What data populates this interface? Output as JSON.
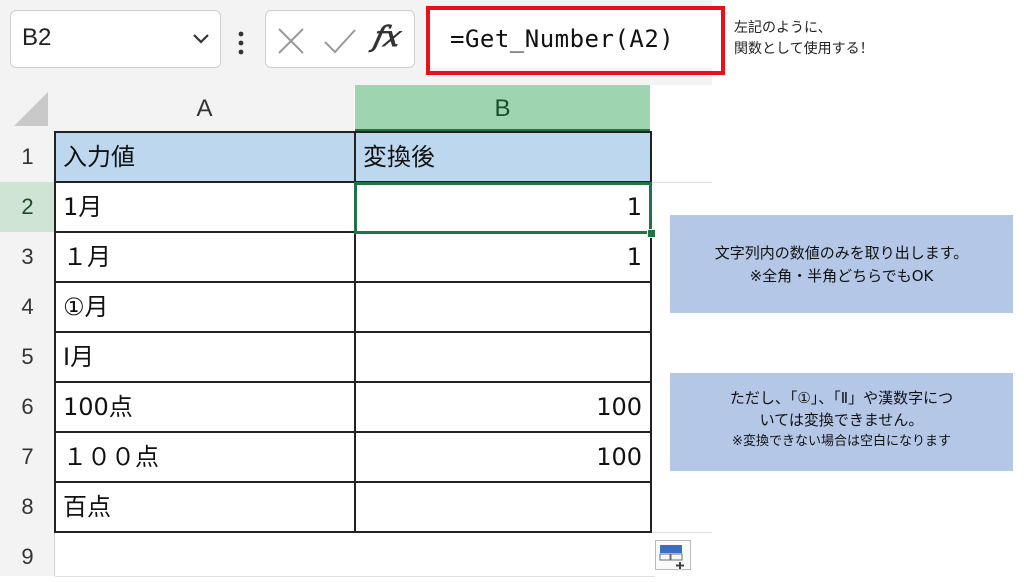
{
  "name_box": {
    "value": "B2"
  },
  "formula_bar": {
    "formula": "=Get_Number(A2)"
  },
  "top_note": {
    "line1": "左記のように、",
    "line2": "関数として使用する！"
  },
  "columns": [
    {
      "label": "A"
    },
    {
      "label": "B"
    }
  ],
  "rows": [
    {
      "num": "1",
      "a": "入力値",
      "b": "変換後"
    },
    {
      "num": "2",
      "a": "1月",
      "b": "1"
    },
    {
      "num": "3",
      "a": "１月",
      "b": "1"
    },
    {
      "num": "4",
      "a": "①月",
      "b": ""
    },
    {
      "num": "5",
      "a": "Ⅰ月",
      "b": ""
    },
    {
      "num": "6",
      "a": "100点",
      "b": "100"
    },
    {
      "num": "7",
      "a": "１００点",
      "b": "100"
    },
    {
      "num": "8",
      "a": "百点",
      "b": ""
    },
    {
      "num": "9",
      "a": "",
      "b": ""
    }
  ],
  "note1": {
    "line1": "文字列内の数値のみを取り出します。",
    "line2": "※全角・半角どちらでもOK"
  },
  "note2": {
    "line1": "ただし、「①」、「Ⅱ」や漢数字につ",
    "line2": "いては変換できません。",
    "line3": "※変換できない場合は空白になります"
  },
  "colors": {
    "accent": "#217346",
    "highlight": "#e8101b",
    "header_fill": "#bdd7ee",
    "note_fill": "#b4c7e7"
  }
}
